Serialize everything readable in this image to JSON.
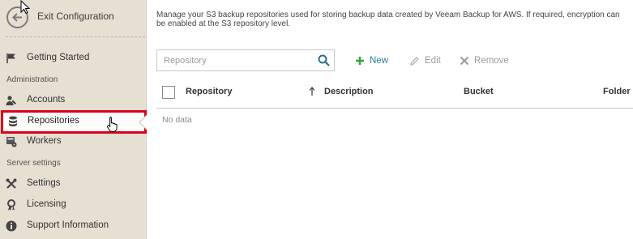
{
  "sidebar": {
    "exit_label": "Exit Configuration",
    "items": [
      {
        "label": "Getting Started",
        "icon": "flag-icon"
      },
      {
        "label": "Accounts",
        "icon": "users-icon"
      },
      {
        "label": "Repositories",
        "icon": "database-icon",
        "selected": true
      },
      {
        "label": "Workers",
        "icon": "worker-icon"
      },
      {
        "label": "Settings",
        "icon": "tools-icon"
      },
      {
        "label": "Licensing",
        "icon": "license-icon"
      },
      {
        "label": "Support Information",
        "icon": "info-icon"
      }
    ],
    "sections": {
      "administration": "Administration",
      "server_settings": "Server settings"
    }
  },
  "main": {
    "description": "Manage your S3 backup repositories used for storing backup data created by Veeam Backup for AWS. If required, encryption can be enabled at the S3 repository level.",
    "search_placeholder": "Repository",
    "toolbar": {
      "new": "New",
      "edit": "Edit",
      "remove": "Remove"
    },
    "columns": [
      "Repository",
      "Description",
      "Bucket",
      "Folder"
    ],
    "empty_text": "No data"
  },
  "colors": {
    "sidebar_bg": "#e6e0d3",
    "accent": "#2e7b9d",
    "new_icon": "#3aa13a",
    "highlight": "#e0001b"
  }
}
